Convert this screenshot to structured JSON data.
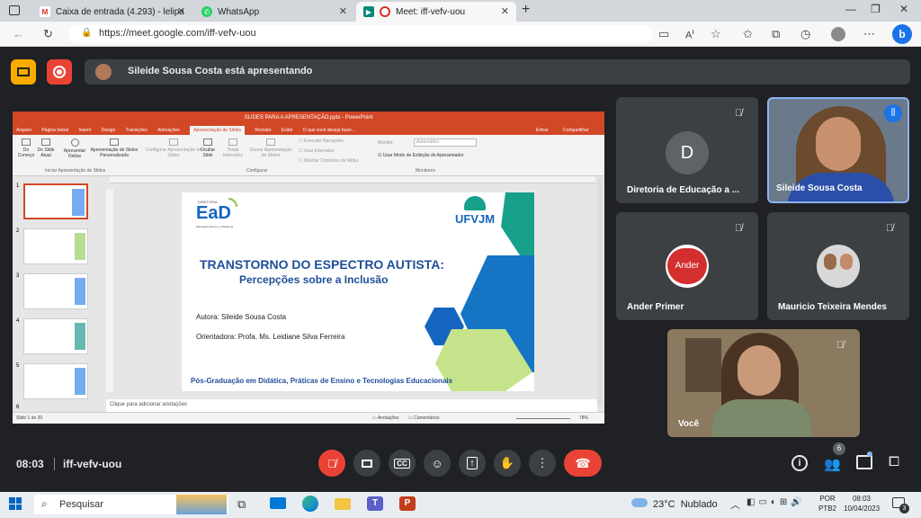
{
  "browser": {
    "tabs": [
      {
        "title": "Caixa de entrada (4.293) - lelipa",
        "icon": "gmail-icon"
      },
      {
        "title": "WhatsApp",
        "icon": "whatsapp-icon"
      },
      {
        "title": "Meet: iff-vefv-uou",
        "icon": "meet-icon"
      }
    ],
    "url": "https://meet.google.com/iff-vefv-uou"
  },
  "meet": {
    "presenting_text": "Sileide Sousa Costa está apresentando",
    "time": "08:03",
    "meeting_code": "iff-vefv-uou",
    "participants_count": "6",
    "participants": [
      {
        "name": "Diretoria de Educação a ...",
        "initial": "D"
      },
      {
        "name": "Sileide Sousa Costa"
      },
      {
        "name": "Ander Primer",
        "avatar_text": "Ander"
      },
      {
        "name": "Mauricio Teixeira Mendes"
      },
      {
        "name": "Você"
      }
    ]
  },
  "ppt": {
    "title": "SLIDES PARA A APRESENTAÇÃO.pptx - PowerPoint",
    "menu": [
      "Arquivo",
      "Página Inicial",
      "Inserir",
      "Design",
      "Transições",
      "Animações",
      "Apresentação de Slides",
      "Revisão",
      "Exibir"
    ],
    "tell_me": "O que você deseja fazer...",
    "enter": "Entrar",
    "share": "Compartilhar",
    "ribbon": {
      "from_start": "Do Começo",
      "from_current": "Do Slide Atual",
      "present_online": "Apresentar Online",
      "custom": "Apresentação de Slides Personalizada",
      "group1": "Iniciar Apresentação de Slides",
      "setup": "Configurar Apresentação de Slides",
      "hide": "Ocultar Slide",
      "rehearse": "Testar Intervalos",
      "record": "Gravar Apresentação de Slides",
      "play_narr": "Executar Narrações",
      "use_timings": "Usar Intervalos",
      "show_media": "Mostrar Controles de Mídia",
      "group2": "Configurar",
      "monitor": "Monitor:",
      "monitor_val": "Automático",
      "presenter_view": "Usar Modo de Exibição do Apresentador",
      "group3": "Monitores"
    },
    "slide": {
      "ead": "EaD",
      "ead_sub": "DIRETORIA",
      "ead_caption": "Educação Aberta e a Distância",
      "ufvjm": "UFVJM",
      "title": "TRANSTORNO DO ESPECTRO AUTISTA:",
      "subtitle": "Percepções sobre a Inclusão",
      "author": "Autora: Sileide Sousa Costa",
      "advisor": "Orientadora: Profa.  Ms. Leidiane Silva Ferreira",
      "footer": "Pós-Graduação em Didática, Práticas de Ensino e Tecnologias Educacionais"
    },
    "notes": "Clique para adicionar anotações",
    "status_left": "Slide 1 de 20",
    "notes_btn": "Anotações",
    "comments_btn": "Comentários",
    "zoom": "78%",
    "thumb_numbers": [
      "1",
      "2",
      "3",
      "4",
      "5",
      "6"
    ]
  },
  "taskbar": {
    "search": "Pesquisar",
    "weather": "23°C  Nublado",
    "lang1": "POR",
    "lang2": "PTB2",
    "time": "08:03",
    "date": "10/04/2023",
    "notif": "3"
  },
  "colors": {
    "accent": "#8ab4f8",
    "hangup": "#ea4335",
    "ppt_orange": "#d24726"
  }
}
